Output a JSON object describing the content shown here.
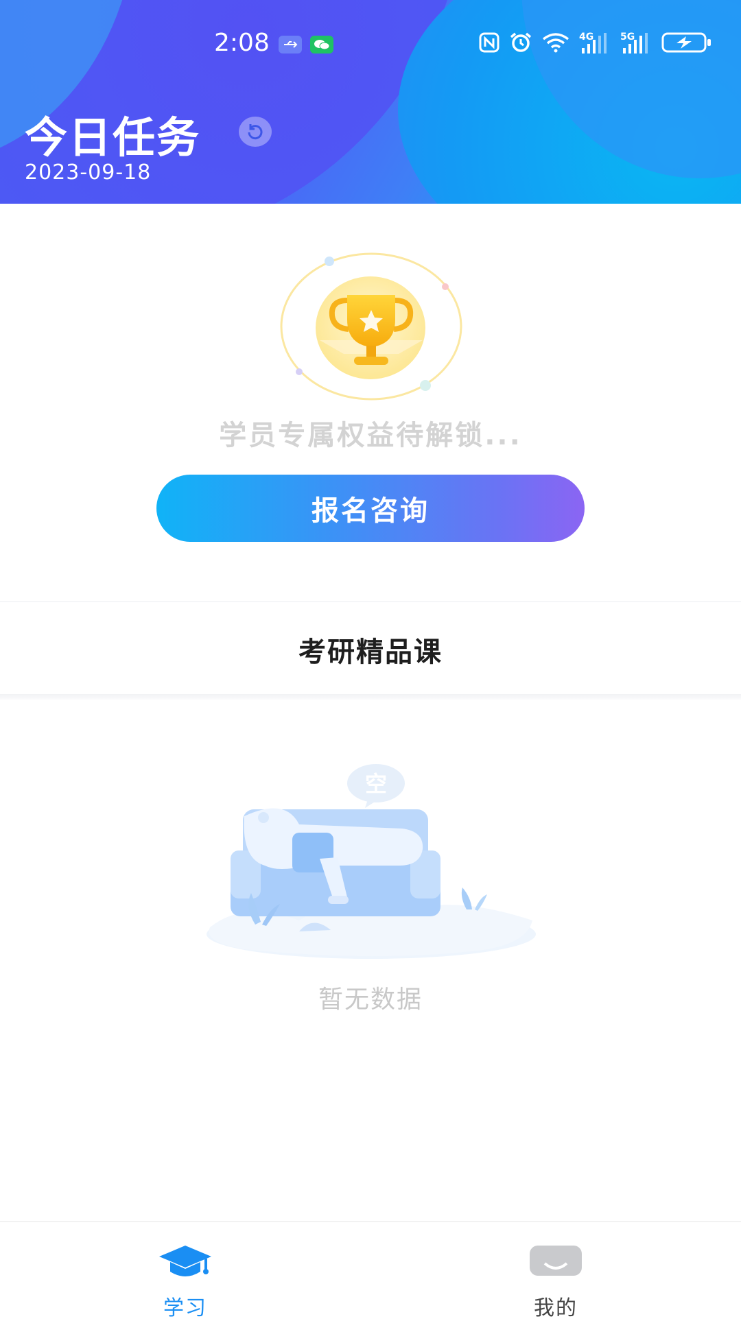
{
  "status_bar": {
    "time": "2:08",
    "icons": [
      "usb-icon",
      "wechat-icon",
      "nfc-icon",
      "alarm-icon",
      "wifi-icon",
      "signal-4g-icon",
      "signal-5g-icon",
      "battery-charging-icon"
    ],
    "network_4g": "4G",
    "network_5g": "5G"
  },
  "header": {
    "title": "今日任务",
    "date": "2023-09-18"
  },
  "promo": {
    "locked_text": "学员专属权益待解锁...",
    "consult_button": "报名咨询"
  },
  "section": {
    "title": "考研精品课"
  },
  "empty_state": {
    "bubble_char": "空",
    "text": "暂无数据"
  },
  "bottom_nav": {
    "items": [
      {
        "label": "学习",
        "icon": "graduation-cap-icon",
        "active": true
      },
      {
        "label": "我的",
        "icon": "profile-icon",
        "active": false
      }
    ]
  },
  "colors": {
    "accent": "#1a8ef3",
    "button_gradient_start": "#10b3f7",
    "button_gradient_end": "#8b65f3"
  }
}
